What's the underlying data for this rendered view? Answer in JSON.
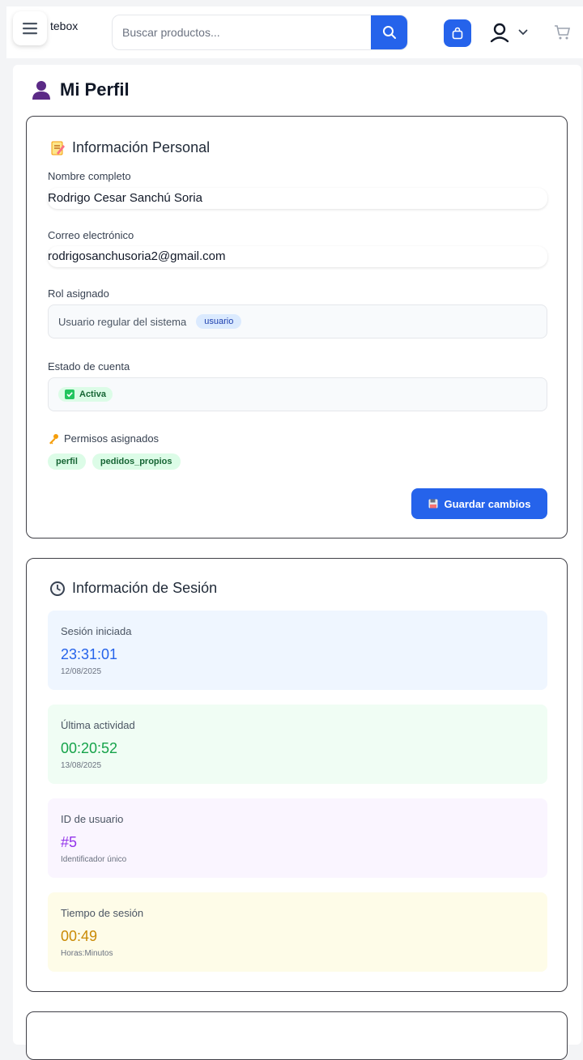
{
  "header": {
    "brand_fragment": "tebox",
    "search_placeholder": "Buscar productos...",
    "icons": {
      "menu": "menu-icon",
      "search": "search-icon",
      "bag": "shopping-bag-icon",
      "user": "user-icon",
      "chevron": "chevron-down-icon",
      "cart": "cart-icon"
    },
    "accent": "#2563eb"
  },
  "page": {
    "title": "Mi Perfil"
  },
  "personal": {
    "title": "Información Personal",
    "name_label": "Nombre completo",
    "name_value": "Rodrigo Cesar Sanchú Soria",
    "email_label": "Correo electrónico",
    "email_value": "rodrigosanchusoria2@gmail.com",
    "role_label": "Rol asignado",
    "role_text": "Usuario regular del sistema",
    "role_badge": "usuario",
    "status_label": "Estado de cuenta",
    "status_badge": "Activa",
    "perms_label": "Permisos asignados",
    "perms": [
      "perfil",
      "pedidos_propios"
    ],
    "save_label": "Guardar cambios"
  },
  "session": {
    "title": "Información de Sesión",
    "stats": [
      {
        "label": "Sesión iniciada",
        "value": "23:31:01",
        "sub": "12/08/2025",
        "bg": "#eff6ff",
        "color": "#2563eb"
      },
      {
        "label": "Última actividad",
        "value": "00:20:52",
        "sub": "13/08/2025",
        "bg": "#f0fdf4",
        "color": "#16a34a"
      },
      {
        "label": "ID de usuario",
        "value": "#5",
        "sub": "Identificador único",
        "bg": "#faf5ff",
        "color": "#9333ea"
      },
      {
        "label": "Tiempo de sesión",
        "value": "00:49",
        "sub": "Horas:Minutos",
        "bg": "#fefce8",
        "color": "#ca8a04"
      }
    ]
  }
}
